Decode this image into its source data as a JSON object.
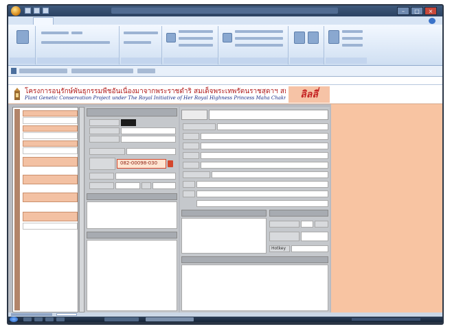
{
  "window": {
    "title": "",
    "controls": {
      "minimize": "–",
      "maximize": "□",
      "close": "×"
    }
  },
  "ribbon": {
    "tabs": [
      "",
      "",
      "",
      "",
      ""
    ],
    "groups": [
      {
        "label": ""
      },
      {
        "label": ""
      },
      {
        "label": ""
      },
      {
        "label": ""
      },
      {
        "label": ""
      },
      {
        "label": ""
      },
      {
        "label": ""
      }
    ]
  },
  "banner": {
    "title_th": "โครงการอนุรักษ์พันธุกรรมพืชอันเนื่องมาจากพระราชดำริ สมเด็จพระเทพรัตนราชสุดาฯ สยามบรมราชกุมารี",
    "title_en": "Plant Genetic Conservation Project under The Royal Initiative of Her Royal Highness Princess Maha Chakri Sirindhorn",
    "brand": "ลิลลี่",
    "logo_icon": "emblem-icon"
  },
  "nav": {
    "headers": [
      "",
      "",
      "",
      "",
      "",
      "",
      ""
    ],
    "values": [
      "",
      "",
      ""
    ],
    "note": ""
  },
  "form": {
    "mid_rows": [
      {
        "label": "",
        "value": ""
      },
      {
        "label": "",
        "value": ""
      },
      {
        "label": "",
        "value": ""
      }
    ],
    "code_label": "",
    "code_value": "082-00098-030",
    "section_header": "",
    "note_header": "",
    "note_text": "",
    "title_label": "",
    "title_value": "",
    "right_rows": [
      {
        "label": "",
        "value": ""
      },
      {
        "label": "",
        "value": ""
      },
      {
        "label": "",
        "value": ""
      },
      {
        "label": "",
        "value": ""
      },
      {
        "label": "",
        "value": ""
      },
      {
        "label": "",
        "value": ""
      },
      {
        "label": "",
        "value": ""
      },
      {
        "label": "",
        "value": ""
      }
    ],
    "subform_header": "",
    "info_header": "",
    "info_row_label": "",
    "info_row_unit": "",
    "hotkey_label": "Hotkey",
    "bottom_header": ""
  },
  "colors": {
    "accent_peach": "#f8c4a2",
    "title_red": "#b01b1b",
    "title_blue": "#1b2f8a",
    "highlight_border": "#d4472c"
  }
}
